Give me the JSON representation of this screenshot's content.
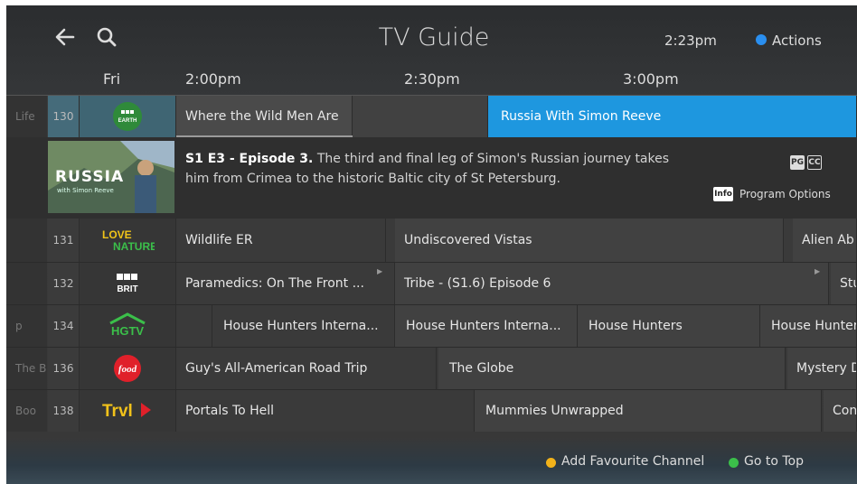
{
  "header": {
    "title": "TV Guide",
    "clock": "2:23pm",
    "actions_label": "Actions",
    "actions_color": "#2a8ff0",
    "back_icon": "back-arrow-icon",
    "search_icon": "search-icon"
  },
  "timeline": {
    "day": "Fri",
    "slots": [
      "2:00pm",
      "2:30pm",
      "3:00pm"
    ]
  },
  "rows": [
    {
      "edge": "Life",
      "number": "130",
      "logo": "BBC EARTH",
      "programs": [
        {
          "title": "Where the Wild Men Are"
        },
        {
          "title": "Russia With Simon Reeve"
        }
      ]
    },
    {
      "edge": "",
      "number": "131",
      "logo": "Love Nature",
      "programs": [
        {
          "title": "Wildlife ER"
        },
        {
          "title": "Undiscovered Vistas"
        },
        {
          "title": "Alien Ab"
        }
      ]
    },
    {
      "edge": "",
      "number": "132",
      "logo": "BBC BRIT",
      "programs": [
        {
          "title": "Paramedics: On The Front ..."
        },
        {
          "title": "Tribe - (S1.6) Episode 6"
        },
        {
          "title": "Stu"
        }
      ]
    },
    {
      "edge": "p",
      "number": "134",
      "logo": "HGTV",
      "programs": [
        {
          "title": ""
        },
        {
          "title": "House Hunters Interna..."
        },
        {
          "title": "House Hunters Interna..."
        },
        {
          "title": "House Hunters"
        },
        {
          "title": "House Hunter"
        }
      ]
    },
    {
      "edge": "The B",
      "number": "136",
      "logo": "food",
      "programs": [
        {
          "title": "Guy's All-American Road Trip"
        },
        {
          "title": "The Globe"
        },
        {
          "title": "Mystery D"
        }
      ]
    },
    {
      "edge": "Boo",
      "number": "138",
      "logo": "Trvl",
      "programs": [
        {
          "title": "Portals To Hell"
        },
        {
          "title": "Mummies Unwrapped"
        },
        {
          "title": "Con"
        }
      ]
    }
  ],
  "detail": {
    "thumb_title": "RUSSIA",
    "thumb_subtitle": "with Simon Reeve",
    "episode": "S1 E3 - Episode 3.",
    "description": "The third and final leg of Simon's Russian journey takes him from Crimea to the historic Baltic city of St Petersburg.",
    "rating": "PG",
    "cc": "CC",
    "info_label": "Info",
    "options_label": "Program Options"
  },
  "footer": {
    "fav_label": "Add Favourite Channel",
    "fav_color": "#f2b21a",
    "top_label": "Go to Top",
    "top_color": "#3bbf4a"
  }
}
